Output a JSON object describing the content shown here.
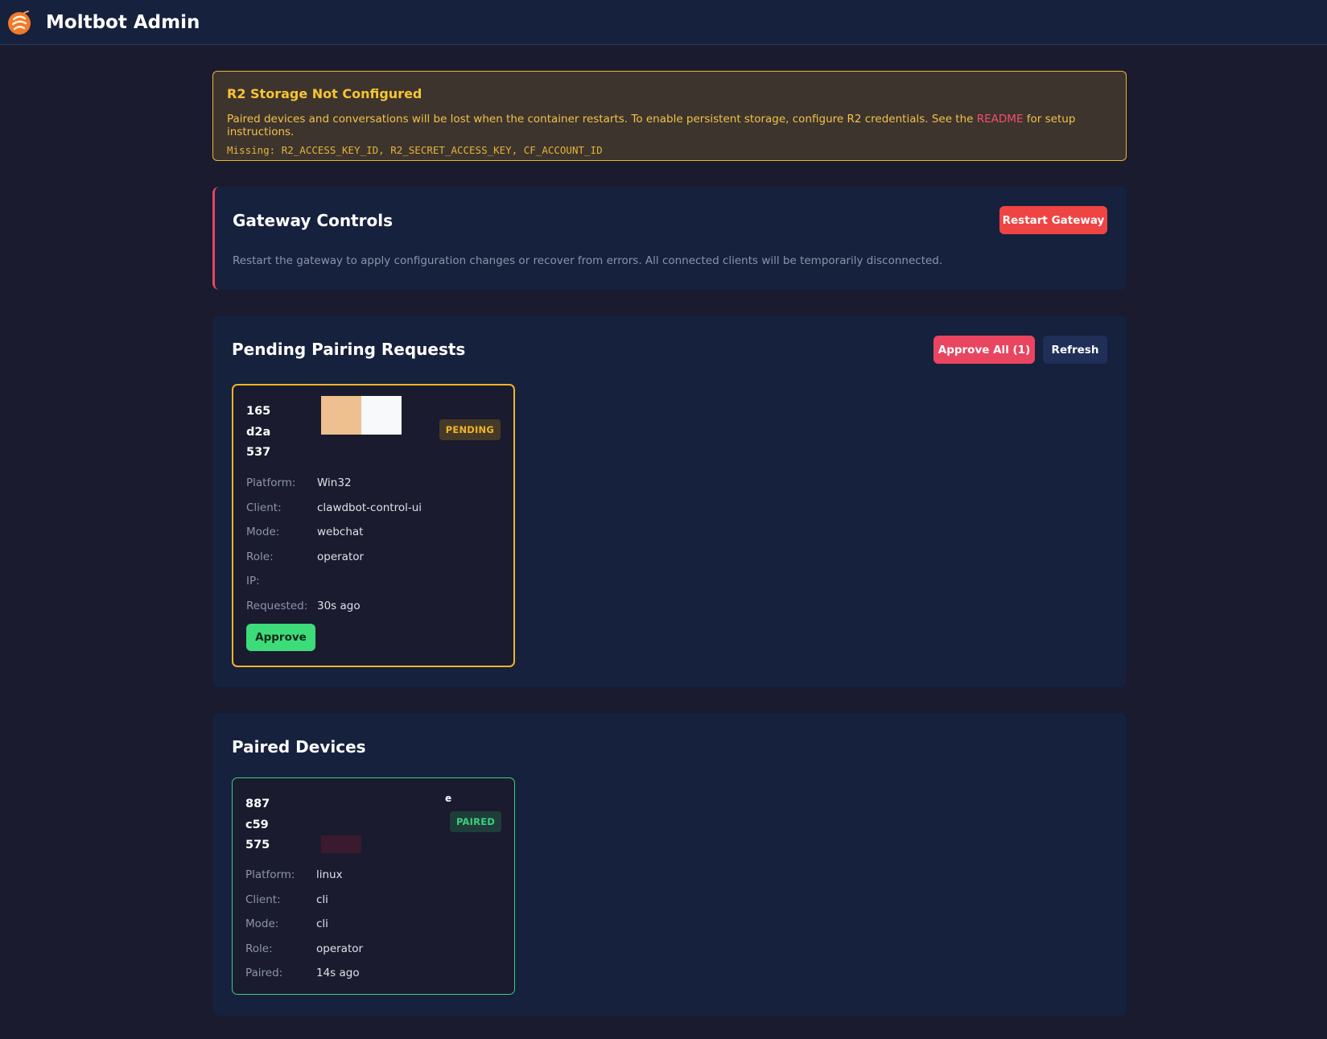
{
  "header": {
    "title": "Moltbot Admin",
    "logo_icon": "lobster-logo-icon"
  },
  "warning": {
    "title": "R2 Storage Not Configured",
    "text_before": "Paired devices and conversations will be lost when the container restarts. To enable persistent storage, configure R2 credentials. See the ",
    "link_label": "README",
    "text_after": " for setup instructions.",
    "missing": "Missing: R2_ACCESS_KEY_ID, R2_SECRET_ACCESS_KEY, CF_ACCOUNT_ID"
  },
  "gateway": {
    "title": "Gateway Controls",
    "restart_label": "Restart Gateway",
    "description": "Restart the gateway to apply configuration changes or recover from errors. All connected clients will be temporarily disconnected."
  },
  "pending": {
    "title": "Pending Pairing Requests",
    "approve_all_label": "Approve All (1)",
    "refresh_label": "Refresh",
    "requests": [
      {
        "id_lines": [
          "165",
          "d2a",
          "537"
        ],
        "badge": "PENDING",
        "details": [
          {
            "label": "Platform:",
            "value": "Win32"
          },
          {
            "label": "Client:",
            "value": "clawdbot-control-ui"
          },
          {
            "label": "Mode:",
            "value": "webchat"
          },
          {
            "label": "Role:",
            "value": "operator"
          },
          {
            "label": "IP:",
            "value": ""
          },
          {
            "label": "Requested:",
            "value": "30s ago"
          }
        ],
        "approve_label": "Approve"
      }
    ]
  },
  "paired": {
    "title": "Paired Devices",
    "devices": [
      {
        "id_lines": [
          "887",
          "c59",
          "575"
        ],
        "stray_char": "e",
        "badge": "PAIRED",
        "details": [
          {
            "label": "Platform:",
            "value": "linux"
          },
          {
            "label": "Client:",
            "value": "cli"
          },
          {
            "label": "Mode:",
            "value": "cli"
          },
          {
            "label": "Role:",
            "value": "operator"
          },
          {
            "label": "Paired:",
            "value": "14s ago"
          }
        ]
      }
    ]
  },
  "colors": {
    "accent": "#e94560",
    "warning": "#f0b429",
    "success": "#3ecf7e",
    "danger": "#ef4444"
  }
}
